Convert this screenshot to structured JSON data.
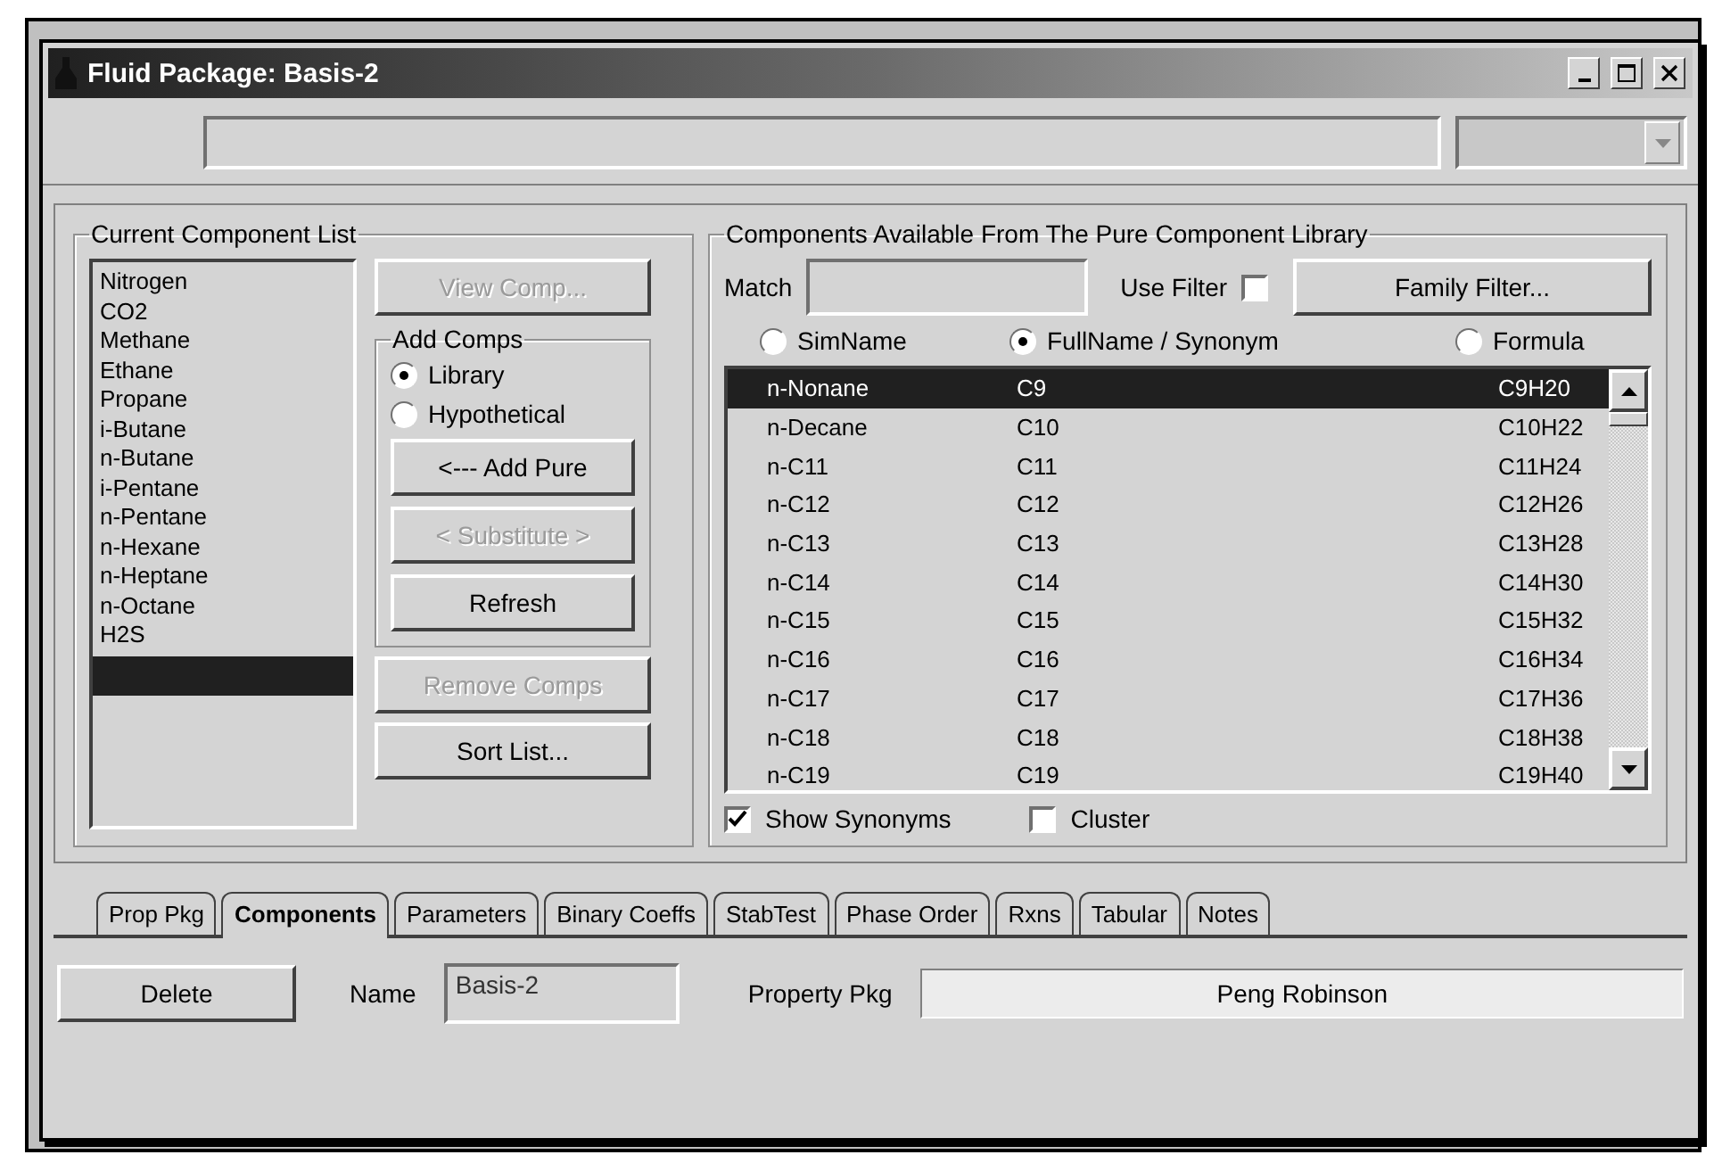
{
  "window": {
    "title": "Fluid Package: Basis-2"
  },
  "top_bar": {
    "dropdown": {
      "disabled": true
    }
  },
  "current_component_list": {
    "title": "Current Component List",
    "items": [
      "Nitrogen",
      "CO2",
      "Methane",
      "Ethane",
      "Propane",
      "i-Butane",
      "n-Butane",
      "i-Pentane",
      "n-Pentane",
      "n-Hexane",
      "n-Heptane",
      "n-Octane",
      "H2S"
    ],
    "insert_row_selected": true,
    "view_button": {
      "label": "View Comp...",
      "disabled": true
    },
    "add_comps": {
      "title": "Add Comps",
      "options": [
        {
          "label": "Library",
          "selected": true
        },
        {
          "label": "Hypothetical",
          "selected": false
        }
      ],
      "buttons": [
        {
          "label": "<--- Add Pure",
          "disabled": false
        },
        {
          "label": "< Substitute >",
          "disabled": true
        },
        {
          "label": "Refresh",
          "disabled": false
        }
      ]
    },
    "buttons": [
      {
        "label": "Remove Comps",
        "disabled": true
      },
      {
        "label": "Sort List...",
        "disabled": false
      }
    ]
  },
  "library": {
    "title": "Components Available From The Pure Component Library",
    "match_label": "Match",
    "use_filter": {
      "label": "Use Filter",
      "checked": false
    },
    "family_filter_button": "Family Filter...",
    "name_modes": [
      {
        "label": "SimName",
        "selected": false
      },
      {
        "label": "FullName / Synonym",
        "selected": true
      },
      {
        "label": "Formula",
        "selected": false
      }
    ],
    "rows": [
      {
        "name": "n-Nonane",
        "simname": "C9",
        "formula": "C9H20",
        "selected": true
      },
      {
        "name": "n-Decane",
        "simname": "C10",
        "formula": "C10H22",
        "selected": false
      },
      {
        "name": "n-C11",
        "simname": "C11",
        "formula": "C11H24",
        "selected": false
      },
      {
        "name": "n-C12",
        "simname": "C12",
        "formula": "C12H26",
        "selected": false
      },
      {
        "name": "n-C13",
        "simname": "C13",
        "formula": "C13H28",
        "selected": false
      },
      {
        "name": "n-C14",
        "simname": "C14",
        "formula": "C14H30",
        "selected": false
      },
      {
        "name": "n-C15",
        "simname": "C15",
        "formula": "C15H32",
        "selected": false
      },
      {
        "name": "n-C16",
        "simname": "C16",
        "formula": "C16H34",
        "selected": false
      },
      {
        "name": "n-C17",
        "simname": "C17",
        "formula": "C17H36",
        "selected": false
      },
      {
        "name": "n-C18",
        "simname": "C18",
        "formula": "C18H38",
        "selected": false
      },
      {
        "name": "n-C19",
        "simname": "C19",
        "formula": "C19H40",
        "selected": false
      }
    ],
    "show_synonyms": {
      "label": "Show Synonyms",
      "checked": true
    },
    "cluster": {
      "label": "Cluster",
      "checked": false
    }
  },
  "tabs": [
    {
      "label": "Prop Pkg",
      "selected": false
    },
    {
      "label": "Components",
      "selected": true
    },
    {
      "label": "Parameters",
      "selected": false
    },
    {
      "label": "Binary Coeffs",
      "selected": false
    },
    {
      "label": "StabTest",
      "selected": false
    },
    {
      "label": "Phase Order",
      "selected": false
    },
    {
      "label": "Rxns",
      "selected": false
    },
    {
      "label": "Tabular",
      "selected": false
    },
    {
      "label": "Notes",
      "selected": false
    }
  ],
  "footer": {
    "delete_button": "Delete",
    "name_label": "Name",
    "name_value": "Basis-2",
    "property_pkg_label": "Property Pkg",
    "property_pkg_value": "Peng Robinson"
  }
}
